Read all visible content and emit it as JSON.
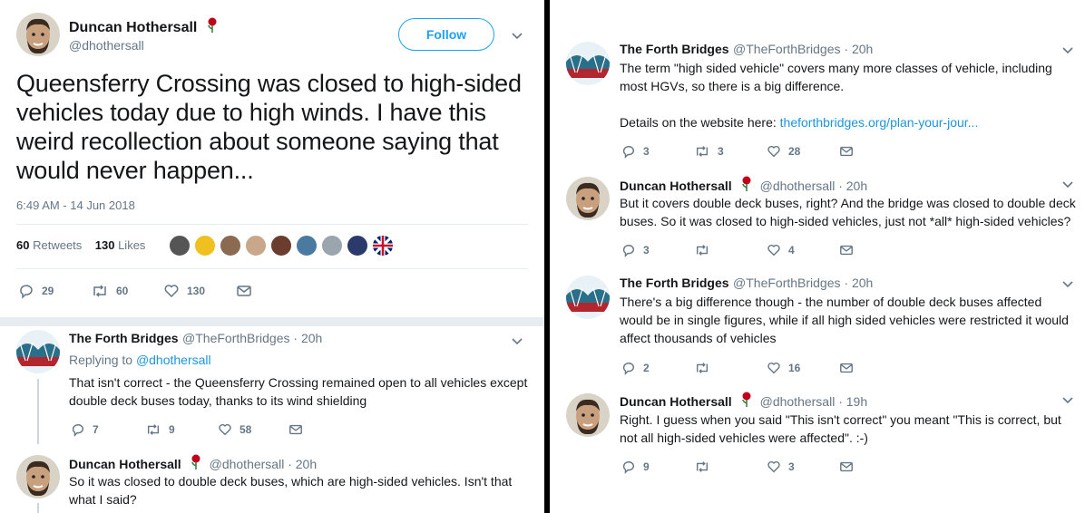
{
  "main_tweet": {
    "author": {
      "name": "Duncan Hothersall",
      "handle": "@dhothersall"
    },
    "follow_label": "Follow",
    "text": "Queensferry Crossing was closed to high-sided vehicles today due to high winds. I have this weird recollection about someone saying that would never happen...",
    "timestamp": "6:49 AM - 14 Jun 2018",
    "retweets_count": "60",
    "retweets_label": "Retweets",
    "likes_count": "130",
    "likes_label": "Likes",
    "actions": {
      "replies": "29",
      "retweets": "60",
      "likes": "130"
    }
  },
  "left_replies": [
    {
      "name": "The Forth Bridges",
      "handle": "@TheForthBridges · 20h",
      "replying_prefix": "Replying to",
      "replying_to": "@dhothersall",
      "text": "That isn't correct - the Queensferry Crossing remained open to all vehicles except double deck buses today, thanks to its wind shielding",
      "replies": "7",
      "retweets": "9",
      "likes": "58"
    },
    {
      "name": "Duncan Hothersall",
      "handle": "@dhothersall · 20h",
      "text": "So it was closed to double deck buses, which are high-sided vehicles. Isn't that what I said?"
    }
  ],
  "right_tweets": [
    {
      "name": "The Forth Bridges",
      "handle": "@TheForthBridges · 20h",
      "text": "The term \"high sided vehicle\" covers many more classes of vehicle, including most HGVs, so there is a big difference.",
      "text2_prefix": "Details on the website here:",
      "text2_link": "theforthbridges.org/plan-your-jour...",
      "replies": "3",
      "retweets": "3",
      "likes": "28"
    },
    {
      "name": "Duncan Hothersall",
      "handle": "@dhothersall · 20h",
      "text": "But it covers double deck buses, right? And the bridge was closed to double deck buses. So it was closed to high-sided vehicles, just not *all* high-sided vehicles?",
      "replies": "3",
      "retweets": "",
      "likes": "4"
    },
    {
      "name": "The Forth Bridges",
      "handle": "@TheForthBridges · 20h",
      "text": "There's a big difference though - the number of double deck buses affected would be in single figures, while if all high sided vehicles were restricted it would affect thousands of vehicles",
      "replies": "2",
      "retweets": "",
      "likes": "16"
    },
    {
      "name": "Duncan Hothersall",
      "handle": "@dhothersall · 19h",
      "text": "Right. I guess when you said \"This isn't correct\" you meant \"This is correct, but not all high-sided vehicles were affected\". :-)",
      "replies": "9",
      "retweets": "",
      "likes": "3"
    }
  ],
  "colors": {
    "accent": "#1da1f2",
    "link": "#1b95e0",
    "muted": "#657786",
    "text": "#14171a",
    "rose": "#c0001a"
  }
}
